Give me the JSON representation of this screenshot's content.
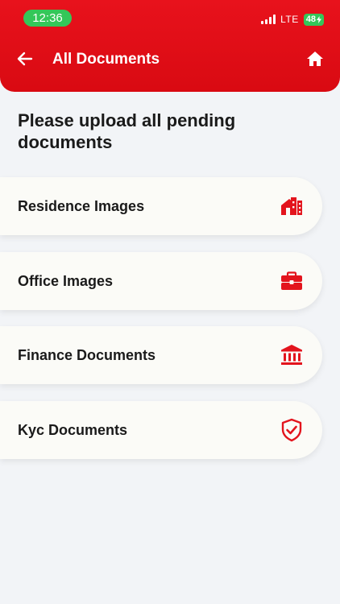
{
  "status_bar": {
    "time": "12:36",
    "network": "LTE",
    "battery": "48"
  },
  "header": {
    "title": "All Documents",
    "back_icon": "arrow-left-icon",
    "home_icon": "home-icon",
    "color": "#e10f18"
  },
  "main": {
    "instructions": "Please upload all pending documents",
    "items": [
      {
        "label": "Residence Images",
        "icon": "residence-icon"
      },
      {
        "label": "Office Images",
        "icon": "briefcase-icon"
      },
      {
        "label": "Finance Documents",
        "icon": "bank-icon"
      },
      {
        "label": "Kyc Documents",
        "icon": "shield-check-icon"
      }
    ]
  },
  "accent_color": "#e3141d"
}
